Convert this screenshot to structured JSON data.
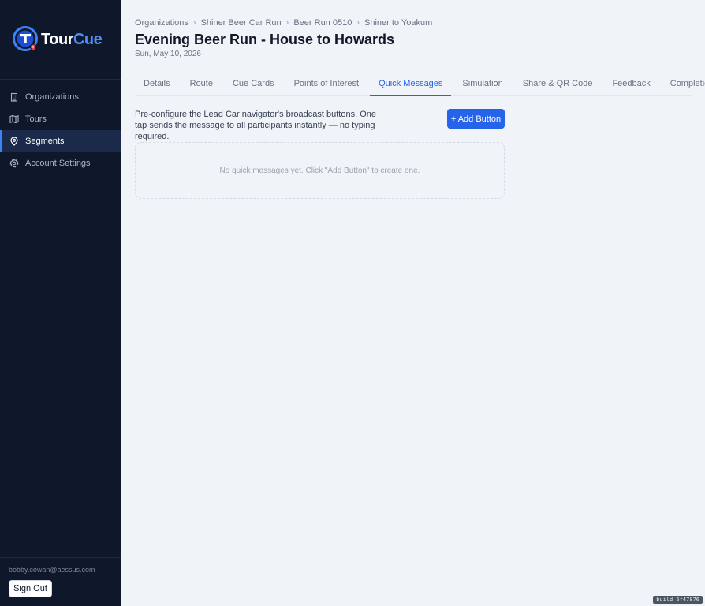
{
  "brand": {
    "name_part1": "Tour",
    "name_part2": "Cue",
    "accent": "#4f8df7",
    "logo_icon": "tourcue-logo-icon"
  },
  "sidebar": {
    "items": [
      {
        "label": "Organizations",
        "icon": "building-icon",
        "active": false
      },
      {
        "label": "Tours",
        "icon": "map-icon",
        "active": false
      },
      {
        "label": "Segments",
        "icon": "location-pin-icon",
        "active": true
      },
      {
        "label": "Account Settings",
        "icon": "gear-icon",
        "active": false
      }
    ],
    "user_email": "bobby.cowan@aessus.com",
    "signout_label": "Sign Out"
  },
  "breadcrumb": [
    "Organizations",
    "Shiner Beer Car Run",
    "Beer Run 0510",
    "Shiner to Yoakum"
  ],
  "page": {
    "title": "Evening Beer Run - House to Howards",
    "date": "Sun, May 10, 2026"
  },
  "tabs": [
    {
      "label": "Details",
      "active": false
    },
    {
      "label": "Route",
      "active": false
    },
    {
      "label": "Cue Cards",
      "active": false
    },
    {
      "label": "Points of Interest",
      "active": false
    },
    {
      "label": "Quick Messages",
      "active": true
    },
    {
      "label": "Simulation",
      "active": false
    },
    {
      "label": "Share & QR Code",
      "active": false
    },
    {
      "label": "Feedback",
      "active": false
    },
    {
      "label": "Completions",
      "active": false
    }
  ],
  "quick_messages": {
    "description": "Pre-configure the Lead Car navigator's broadcast buttons. One tap sends the message to all participants instantly — no typing required.",
    "add_button_label": "+ Add Button",
    "empty_text": "No quick messages yet. Click \"Add Button\" to create one."
  },
  "build_tag": "build 5f47876",
  "colors": {
    "sidebar_bg": "#0f172a",
    "primary": "#2563eb",
    "page_bg": "#f0f3f8"
  }
}
